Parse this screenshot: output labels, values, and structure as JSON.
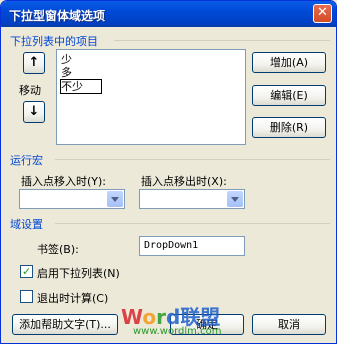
{
  "window": {
    "title": "下拉型窗体域选项",
    "close_glyph": "✕"
  },
  "dropdown_items_group": {
    "label": "下拉列表中的项目",
    "items": [
      "少",
      "多",
      "不少"
    ],
    "selected_index": 2,
    "move_label": "移动",
    "up_glyph": "↑",
    "down_glyph": "↓",
    "add_label": "增加(A)",
    "edit_label": "编辑(E)",
    "delete_label": "删除(R)"
  },
  "run_macro_group": {
    "label": "运行宏",
    "entry_label": "插入点移入时(Y):",
    "exit_label": "插入点移出时(X):",
    "entry_value": "",
    "exit_value": ""
  },
  "field_settings_group": {
    "label": "域设置",
    "bookmark_label": "书签(B):",
    "bookmark_value": "DropDown1",
    "enable_dropdown_label": "启用下拉列表(N)",
    "enable_dropdown_checked": true,
    "calculate_on_exit_label": "退出时计算(C)",
    "calculate_on_exit_checked": false
  },
  "footer": {
    "help_text_label": "添加帮助文字(T)...",
    "ok_label": "确定",
    "cancel_label": "取消"
  },
  "watermark": {
    "brand_word": "Word",
    "brand_cjk": "联盟",
    "url": "www.wordlm.com",
    "colors": {
      "W": "#d9262c",
      "o": "#f29a1e",
      "r": "#2a9a2a",
      "d": "#1e5fc9",
      "cjk": "#1e5fc9"
    }
  }
}
